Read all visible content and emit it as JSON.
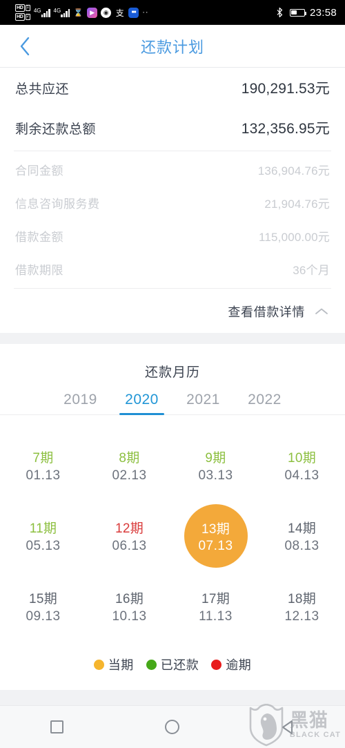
{
  "status_bar": {
    "hd_labels": [
      "HD",
      "HD"
    ],
    "network_labels": [
      "4G",
      "4G"
    ],
    "icons": [
      "hourglass-icon",
      "media-app-icon",
      "shield-app-icon",
      "alipay-app-icon",
      "blue-app-icon",
      "more-dots-icon"
    ],
    "bluetooth": "bluetooth-icon",
    "battery_percent": 45,
    "time": "23:58"
  },
  "header": {
    "back": "back-chevron",
    "title": "还款计划"
  },
  "summary": {
    "rows": [
      {
        "label": "总共应还",
        "value": "190,291.53元"
      },
      {
        "label": "剩余还款总额",
        "value": "132,356.95元"
      }
    ],
    "details": [
      {
        "label": "合同金额",
        "value": "136,904.76元"
      },
      {
        "label": "信息咨询服务费",
        "value": "21,904.76元"
      },
      {
        "label": "借款金额",
        "value": "115,000.00元"
      },
      {
        "label": "借款期限",
        "value": "36个月"
      }
    ],
    "toggle": {
      "label": "查看借款详情",
      "icon": "chevron-up-icon",
      "expanded": true
    }
  },
  "calendar": {
    "title": "还款月历",
    "years": [
      {
        "label": "2019",
        "active": false
      },
      {
        "label": "2020",
        "active": true
      },
      {
        "label": "2021",
        "active": false
      },
      {
        "label": "2022",
        "active": false
      }
    ],
    "cells": [
      {
        "period": "7期",
        "date": "01.13",
        "state": "paid"
      },
      {
        "period": "8期",
        "date": "02.13",
        "state": "paid"
      },
      {
        "period": "9期",
        "date": "03.13",
        "state": "paid"
      },
      {
        "period": "10期",
        "date": "04.13",
        "state": "paid"
      },
      {
        "period": "11期",
        "date": "05.13",
        "state": "paid"
      },
      {
        "period": "12期",
        "date": "06.13",
        "state": "overdue"
      },
      {
        "period": "13期",
        "date": "07.13",
        "state": "current"
      },
      {
        "period": "14期",
        "date": "08.13",
        "state": "future"
      },
      {
        "period": "15期",
        "date": "09.13",
        "state": "future"
      },
      {
        "period": "16期",
        "date": "10.13",
        "state": "future"
      },
      {
        "period": "17期",
        "date": "11.13",
        "state": "future"
      },
      {
        "period": "18期",
        "date": "12.13",
        "state": "future"
      }
    ],
    "legend": [
      {
        "label": "当期",
        "color": "#f5b52e"
      },
      {
        "label": "已还款",
        "color": "#46a818"
      },
      {
        "label": "逾期",
        "color": "#e81c1c"
      }
    ]
  },
  "bottom_nav": {
    "items": [
      "recents-square-icon",
      "home-circle-icon",
      "back-triangle-icon"
    ]
  },
  "watermark": {
    "cn": "黑猫",
    "en": "BLACK CAT"
  },
  "colors": {
    "accent_blue": "#2196d6",
    "title_blue": "#4a9ae0",
    "paid_green": "#8cbf3f",
    "overdue_red": "#d93a3a",
    "current_orange": "#f3a93a",
    "muted_gray": "#c9ccd1"
  }
}
